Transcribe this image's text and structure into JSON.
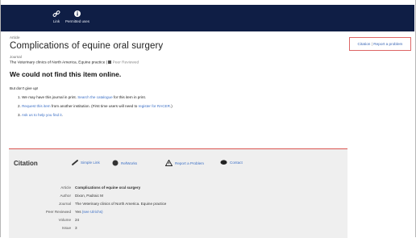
{
  "topbar": {
    "items": [
      {
        "label": "Link",
        "icon": "link-icon"
      },
      {
        "label": "Permitted uses",
        "icon": "info-icon"
      }
    ],
    "background": "#0f1e45"
  },
  "record": {
    "type_label": "Article",
    "title": "Complications of equine oral surgery",
    "journal_label": "Journal",
    "journal": "The Veterinary clinics of North America. Equine practice",
    "peer_reviewed": "Peer Reviewed",
    "not_found": "We could not find this item online.",
    "dont_give_up": "But don't give up!",
    "steps": [
      {
        "pre": "1. We may have this journal in print. ",
        "link": "Search the catalogue",
        "post": " for this item in print."
      },
      {
        "pre": "2. ",
        "link": "Request this item",
        "post": " from another institution. (First time users will need to ",
        "link2": "register for RACER",
        "post2": ".)"
      },
      {
        "pre": "3. ",
        "link": "Ask us to help you find it",
        "post": "."
      }
    ]
  },
  "side": {
    "citation": "Citation",
    "separator": " | ",
    "report": "Report a problem",
    "border_color": "#dd6666"
  },
  "citation_panel": {
    "title": "Citation",
    "tabs": [
      {
        "label": "Simple Link",
        "icon": "link-icon"
      },
      {
        "label": "RefWorks",
        "icon": "refworks-icon"
      },
      {
        "label": "Report a Problem",
        "icon": "warning-icon"
      },
      {
        "label": "Contact",
        "icon": "chat-icon"
      }
    ],
    "accent": "#d9534f",
    "rows": [
      {
        "key": "Article",
        "value": "Complications of equine oral surgery",
        "bold": true
      },
      {
        "key": "Author",
        "value": "Dixon, Padraic M"
      },
      {
        "key": "Journal",
        "value": "The Veterinary clinics of North America. Equine practice"
      },
      {
        "key": "Peer Reviewed",
        "value": "Yes",
        "link": "(see Ulrichs)"
      },
      {
        "key": "Volume",
        "value": "24"
      },
      {
        "key": "Issue",
        "value": "3"
      }
    ]
  }
}
